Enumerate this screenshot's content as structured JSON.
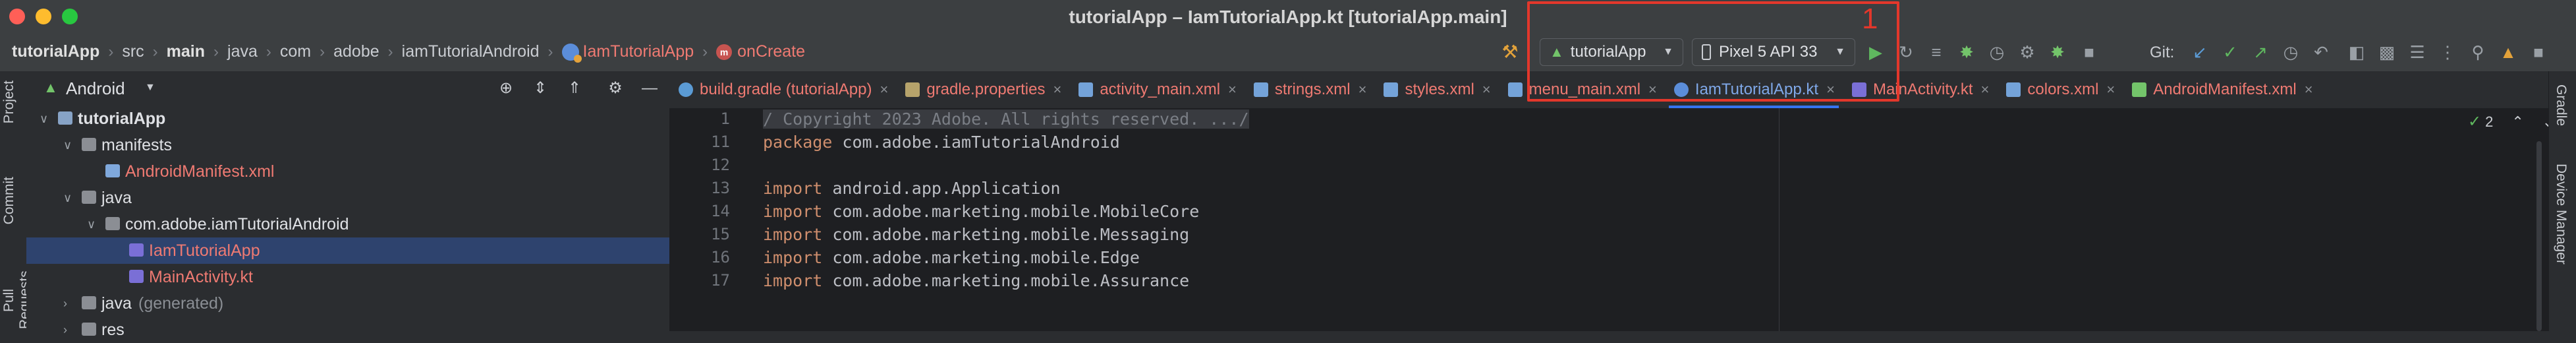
{
  "window": {
    "title": "tutorialApp – IamTutorialApp.kt [tutorialApp.main]"
  },
  "breadcrumb": [
    {
      "label": "tutorialApp",
      "style": "bold"
    },
    {
      "label": "src",
      "style": "normal"
    },
    {
      "label": "main",
      "style": "bold"
    },
    {
      "label": "java",
      "style": "normal"
    },
    {
      "label": "com",
      "style": "normal"
    },
    {
      "label": "adobe",
      "style": "normal"
    },
    {
      "label": "iamTutorialAndroid",
      "style": "normal"
    },
    {
      "label": "IamTutorialApp",
      "style": "class",
      "icon": "kotlin-class-icon"
    },
    {
      "label": "onCreate",
      "style": "function",
      "icon": "function-icon"
    }
  ],
  "toolbar": {
    "run_config": "tutorialApp",
    "device": "Pixel 5 API 33",
    "git_label": "Git:",
    "annotation_number": "1"
  },
  "colors": {
    "accent": "#3574f0",
    "annotation": "#e3372b",
    "run_green": "#5fb85f",
    "error_red": "#ef7a72"
  },
  "project_panel": {
    "title": "Android",
    "tree": [
      {
        "label": "tutorialApp",
        "depth": 0,
        "arrow": "down",
        "icon": "module-folder-icon",
        "bold": true
      },
      {
        "label": "manifests",
        "depth": 1,
        "arrow": "down",
        "icon": "folder-icon"
      },
      {
        "label": "AndroidManifest.xml",
        "depth": 2,
        "arrow": "",
        "icon": "manifest-file-icon",
        "red": true
      },
      {
        "label": "java",
        "depth": 1,
        "arrow": "down",
        "icon": "folder-icon"
      },
      {
        "label": "com.adobe.iamTutorialAndroid",
        "depth": 2,
        "arrow": "down",
        "icon": "package-icon"
      },
      {
        "label": "IamTutorialApp",
        "depth": 3,
        "arrow": "",
        "icon": "kotlin-class-icon",
        "red": true,
        "selected": true
      },
      {
        "label": "MainActivity.kt",
        "depth": 3,
        "arrow": "",
        "icon": "kotlin-file-icon",
        "red": true
      },
      {
        "label": "java",
        "depth": 1,
        "arrow": "right",
        "icon": "folder-icon",
        "suffix": "(generated)"
      },
      {
        "label": "res",
        "depth": 1,
        "arrow": "right",
        "icon": "folder-icon"
      }
    ]
  },
  "left_toolwindows": [
    "Project",
    "Commit",
    "Pull Requests"
  ],
  "right_toolwindows": [
    "Gradle",
    "Device Manager"
  ],
  "tabs": [
    {
      "label": "build.gradle (tutorialApp)",
      "icon": "gradle",
      "color": "orange"
    },
    {
      "label": "gradle.properties",
      "icon": "props",
      "color": "orange"
    },
    {
      "label": "activity_main.xml",
      "icon": "xmlb",
      "color": "orange"
    },
    {
      "label": "strings.xml",
      "icon": "xmlb",
      "color": "orange"
    },
    {
      "label": "styles.xml",
      "icon": "xmlb",
      "color": "orange"
    },
    {
      "label": "menu_main.xml",
      "icon": "xmlb",
      "color": "orange"
    },
    {
      "label": "IamTutorialApp.kt",
      "icon": "ktblue",
      "color": "blue",
      "active": true
    },
    {
      "label": "MainActivity.kt",
      "icon": "kt",
      "color": "orange"
    },
    {
      "label": "colors.xml",
      "icon": "xmlb",
      "color": "orange"
    },
    {
      "label": "AndroidManifest.xml",
      "icon": "manifest",
      "color": "orange"
    }
  ],
  "editor": {
    "inspection_count": "2",
    "lines": [
      {
        "num": "1",
        "text": "/ Copyright 2023 Adobe. All rights reserved. .../",
        "kind": "comment"
      },
      {
        "num": "11",
        "kw": "package",
        "text": " com.adobe.iamTutorialAndroid"
      },
      {
        "num": "12",
        "text": ""
      },
      {
        "num": "13",
        "kw": "import",
        "text": " android.app.Application"
      },
      {
        "num": "14",
        "kw": "import",
        "text": " com.adobe.marketing.mobile.MobileCore"
      },
      {
        "num": "15",
        "kw": "import",
        "text": " com.adobe.marketing.mobile.Messaging"
      },
      {
        "num": "16",
        "kw": "import",
        "text": " com.adobe.marketing.mobile.Edge"
      },
      {
        "num": "17",
        "kw": "import",
        "text": " com.adobe.marketing.mobile.Assurance"
      }
    ]
  }
}
